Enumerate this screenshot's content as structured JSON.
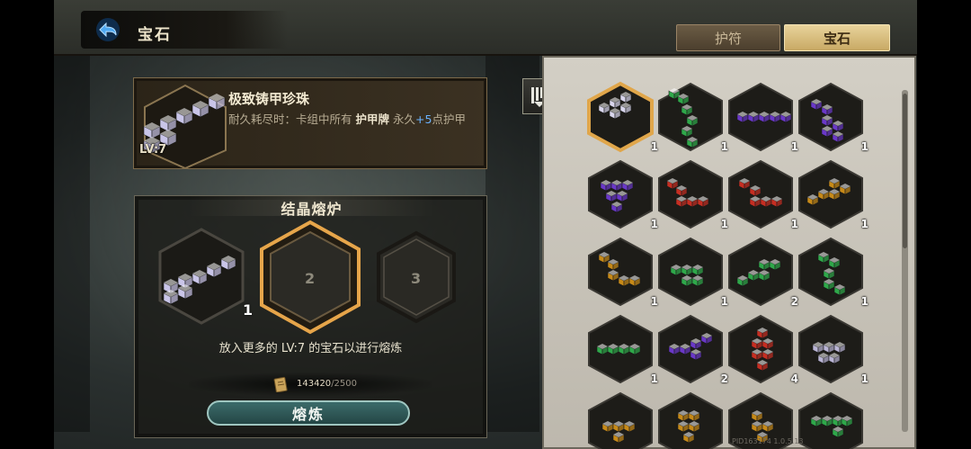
{
  "header": {
    "title": "宝石",
    "tabs": [
      {
        "label": "护符",
        "active": false
      },
      {
        "label": "宝石",
        "active": true
      }
    ]
  },
  "gem_info": {
    "name": "极致铸甲珍珠",
    "desc_prefix": "耐久耗尽时：卡组中所有",
    "desc_target": "护甲牌",
    "desc_mid": "永久",
    "desc_bonus": "+5",
    "desc_suffix": "点护甲",
    "level": "LV:7"
  },
  "furnace": {
    "title": "结晶熔炉",
    "slot1_count": "1",
    "slot2_label": "2",
    "slot3_label": "3",
    "hint": "放入更多的 LV:7 的宝石以进行熔炼",
    "cost_current": "143420",
    "cost_max": "/2500",
    "smelt_label": "熔炼"
  },
  "inventory": [
    {
      "color": "#d9d6ec",
      "count": "1",
      "selected": true
    },
    {
      "color": "#2fa84a",
      "count": "1"
    },
    {
      "color": "#6a38c8",
      "count": "1"
    },
    {
      "color": "#6a38c8",
      "count": "1"
    },
    {
      "color": "#6a38c8",
      "count": "1"
    },
    {
      "color": "#c62e22",
      "count": "1"
    },
    {
      "color": "#c62e22",
      "count": "1"
    },
    {
      "color": "#c78a18",
      "count": "1"
    },
    {
      "color": "#c78a18",
      "count": "1"
    },
    {
      "color": "#2fa84a",
      "count": "1"
    },
    {
      "color": "#2fa84a",
      "count": "2"
    },
    {
      "color": "#2fa84a",
      "count": "1"
    },
    {
      "color": "#2fa84a",
      "count": "1"
    },
    {
      "color": "#6a38c8",
      "count": "2"
    },
    {
      "color": "#c62e22",
      "count": "4"
    },
    {
      "color": "#b9b4d4",
      "count": "1"
    },
    {
      "color": "#c78a18",
      "count": ""
    },
    {
      "color": "#c78a18",
      "count": ""
    },
    {
      "color": "#c78a18",
      "count": ""
    },
    {
      "color": "#2fa84a",
      "count": ""
    }
  ],
  "build": "PID163174  1.0.5.13",
  "colors": {
    "accent_gold": "#e0a64a",
    "tab_active": "#d9bf7e",
    "smelt_button": "#2f5a59"
  },
  "icons": [
    "back-arrow-icon",
    "sort-filter-icon",
    "gold-coin-icon"
  ]
}
